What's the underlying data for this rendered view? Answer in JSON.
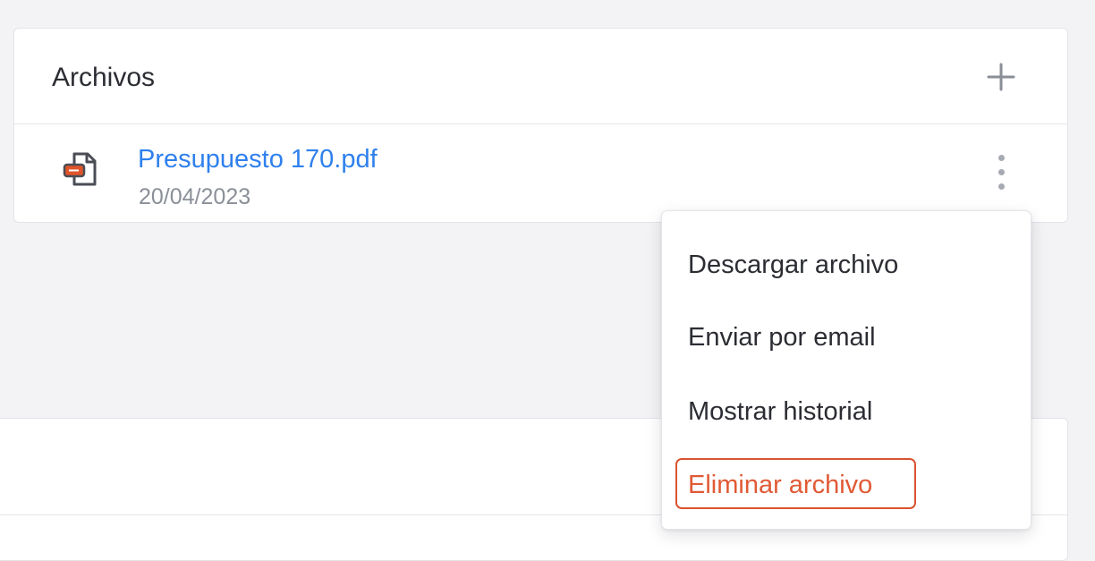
{
  "files_card": {
    "title": "Archivos",
    "add_icon": "plus-icon",
    "files": [
      {
        "name": "Presupuesto 170.pdf",
        "date": "20/04/2023",
        "icon": "pdf-file-icon",
        "actions_icon": "more-vertical-icon"
      }
    ]
  },
  "context_menu": {
    "items": [
      {
        "label": "Descargar archivo"
      },
      {
        "label": "Enviar por email"
      },
      {
        "label": "Mostrar historial"
      },
      {
        "label": "Eliminar archivo",
        "danger": true,
        "highlighted": true
      }
    ]
  },
  "colors": {
    "background": "#f3f3f5",
    "link": "#2f80ed",
    "danger": "#e05a35",
    "pdf_accent": "#e0542a",
    "text": "#2b2d33",
    "muted": "#8b8f98"
  }
}
